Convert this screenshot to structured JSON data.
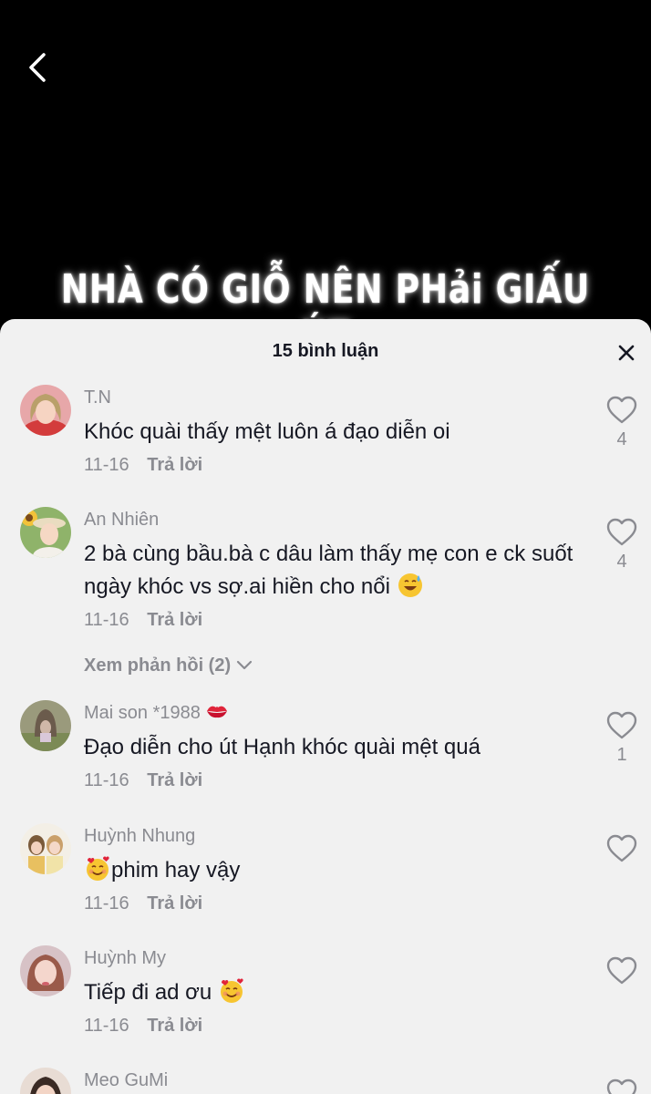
{
  "video": {
    "caption": "NHÀ CÓ GIỖ NÊN PHải GIẤU ÚT",
    "back_icon": "chevron-left-icon"
  },
  "sheet": {
    "title": "15 bình luận",
    "close_icon": "close-icon"
  },
  "comments": [
    {
      "user": "T.N",
      "text": "Khóc quài thấy mệt luôn á đạo diễn oi",
      "date": "11-16",
      "reply": "Trả lời",
      "likes": "4"
    },
    {
      "user": "An Nhiên",
      "text": "2 bà cùng bầu.bà c dâu làm thấy mẹ con e ck suốt ngày khóc vs sợ.ai hiền cho nổi",
      "date": "11-16",
      "reply": "Trả lời",
      "likes": "4",
      "view_replies": "Xem phản hồi (2)"
    },
    {
      "user": "Mai son *1988",
      "text": "Đạo diễn cho út Hạnh khóc quài mệt quá",
      "date": "11-16",
      "reply": "Trả lời",
      "likes": "1"
    },
    {
      "user": "Huỳnh Nhung",
      "text": "phim hay vậy",
      "date": "11-16",
      "reply": "Trả lời",
      "likes": ""
    },
    {
      "user": "Huỳnh My",
      "text": "Tiếp đi ad ơu",
      "date": "11-16",
      "reply": "Trả lời",
      "likes": ""
    },
    {
      "user": "Meo GuMi",
      "text": "",
      "date": "",
      "reply": "",
      "likes": ""
    }
  ],
  "colors": {
    "sheet_bg": "#f1f1f1",
    "primary_text": "#161823",
    "secondary_text": "#8a8b91"
  }
}
